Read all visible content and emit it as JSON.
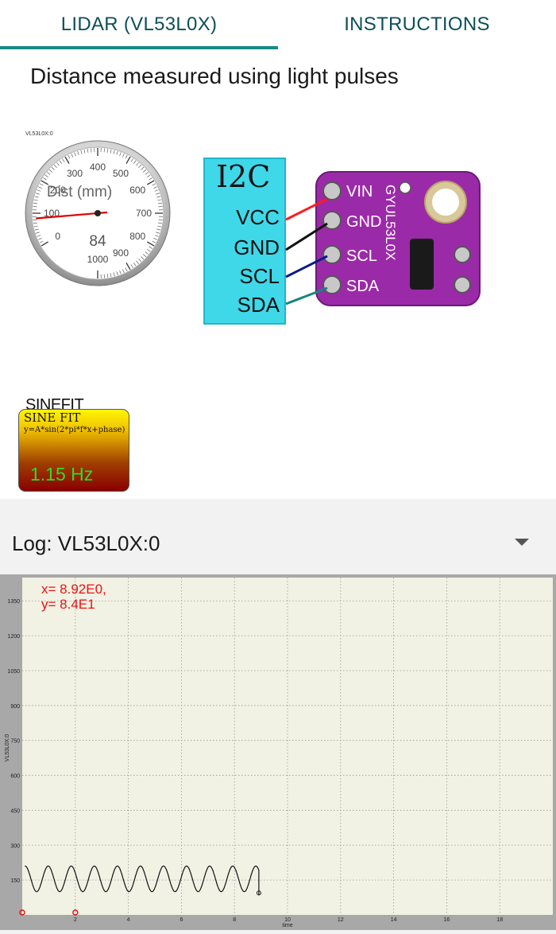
{
  "tabs": [
    {
      "label": "LIDAR (VL53L0X)",
      "active": true
    },
    {
      "label": "INSTRUCTIONS",
      "active": false
    }
  ],
  "colors": {
    "accent": "#168a87",
    "tab_text": "#0d4f58",
    "i2c_bg": "#3ed8e8",
    "plot_bg": "#f1f1e4"
  },
  "heading": "Distance measured using light pulses",
  "gauge": {
    "tag": "VL53L0X:0",
    "label": "Dist (mm)",
    "value": 84,
    "ticks": [
      {
        "text": "0",
        "value": 0
      },
      {
        "text": "100",
        "value": 100
      },
      {
        "text": "200",
        "value": 200
      },
      {
        "text": "300",
        "value": 300
      },
      {
        "text": "400",
        "value": 400
      },
      {
        "text": "500",
        "value": 500
      },
      {
        "text": "600",
        "value": 600
      },
      {
        "text": "700",
        "value": 700
      },
      {
        "text": "800",
        "value": 800
      },
      {
        "text": "900",
        "value": 900
      },
      {
        "text": "1000",
        "value": 1000
      }
    ],
    "min": 0,
    "max": 1000
  },
  "i2c": {
    "title": "I2C",
    "pins": [
      "VCC",
      "GND",
      "SCL",
      "SDA"
    ],
    "wire_colors": [
      "#ff1a1a",
      "#111111",
      "#0a1a8a",
      "#16857f"
    ],
    "board_pins": [
      "VIN",
      "GND",
      "SCL",
      "SDA"
    ],
    "board_label": "GYUL53L0X"
  },
  "sinefit": {
    "caption": "SINEFIT",
    "title": "SINE FIT",
    "formula": "y=A*sin(2*pi*f*x+phase)",
    "value": "1.15 Hz"
  },
  "log": {
    "label": "Log: VL53L0X:0",
    "dropdown_icon": "triangle-down-icon"
  },
  "chart_data": {
    "type": "line",
    "readout": [
      "x= 8.92E0,",
      "y= 8.4E1"
    ],
    "xlabel": "time",
    "ylabel": "VL53L0X:0",
    "xlim": [
      0,
      20
    ],
    "ylim": [
      0,
      1450
    ],
    "xticks": [
      {
        "text": "2",
        "value": 2
      },
      {
        "text": "4",
        "value": 4
      },
      {
        "text": "6",
        "value": 6
      },
      {
        "text": "8",
        "value": 8
      },
      {
        "text": "10",
        "value": 10
      },
      {
        "text": "12",
        "value": 12
      },
      {
        "text": "14",
        "value": 14
      },
      {
        "text": "16",
        "value": 16
      },
      {
        "text": "18",
        "value": 18
      }
    ],
    "yticks": [
      {
        "text": "150",
        "value": 150
      },
      {
        "text": "300",
        "value": 300
      },
      {
        "text": "450",
        "value": 450
      },
      {
        "text": "600",
        "value": 600
      },
      {
        "text": "750",
        "value": 750
      },
      {
        "text": "900",
        "value": 900
      },
      {
        "text": "1050",
        "value": 1050
      },
      {
        "text": "1200",
        "value": 1200
      },
      {
        "text": "1350",
        "value": 1350
      }
    ],
    "grid": true,
    "series": [
      {
        "frequency_hz": 1.15,
        "amplitude": 55,
        "offset": 155,
        "phase": 0.785,
        "x_start": 0.1,
        "x_end": 8.92,
        "end_marker": {
          "x": 8.92,
          "y": 84
        }
      }
    ],
    "markers": [
      {
        "x": 0,
        "y": 0
      },
      {
        "x": 2,
        "y": 0
      }
    ]
  }
}
